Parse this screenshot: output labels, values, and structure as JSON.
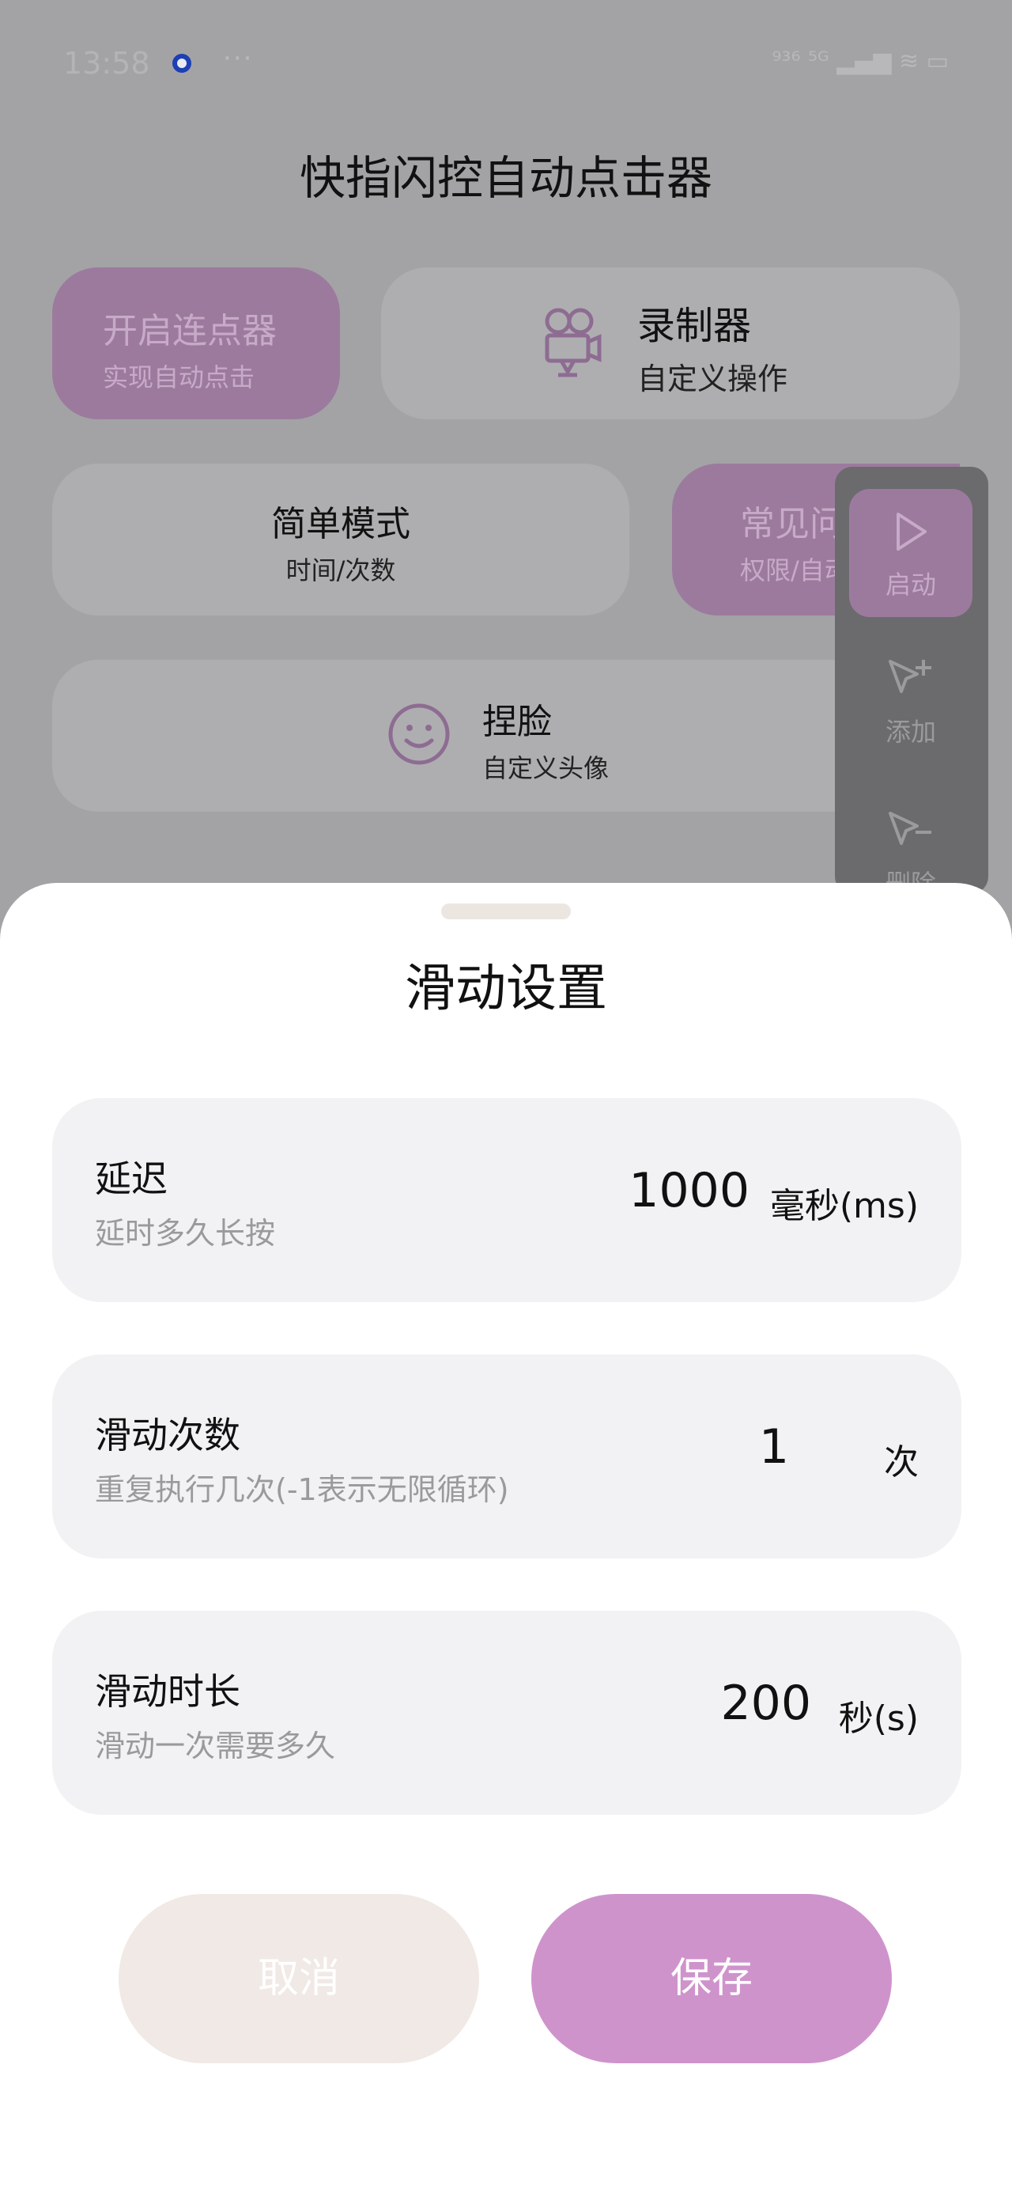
{
  "status_bar": {
    "time": "13:58",
    "more": "···",
    "right": "⁹³⁶ ⁵ᴳ ▂▄▆ ≋ ▭"
  },
  "app": {
    "title": "快指闪控自动点击器"
  },
  "cards": {
    "start_clicker": {
      "title": "开启连点器",
      "subtitle": "实现自动点击"
    },
    "recorder": {
      "title": "录制器",
      "subtitle": "自定义操作"
    },
    "simple_mode": {
      "title": "简单模式",
      "subtitle": "时间/次数"
    },
    "faq": {
      "title": "常见问",
      "subtitle": "权限/自动"
    },
    "pinch_face": {
      "title": "捏脸",
      "subtitle": "自定义头像"
    }
  },
  "float_panel": {
    "start": "启动",
    "add": "添加",
    "remove": "删除"
  },
  "sheet": {
    "title": "滑动设置",
    "rows": [
      {
        "label": "延迟",
        "desc": "延时多久长按",
        "value": "1000",
        "unit": "毫秒(ms)"
      },
      {
        "label": "滑动次数",
        "desc": "重复执行几次(-1表示无限循环)",
        "value": "1",
        "unit": "次"
      },
      {
        "label": "滑动时长",
        "desc": "滑动一次需要多久",
        "value": "200",
        "unit": "秒(s)"
      }
    ],
    "cancel": "取消",
    "save": "保存"
  },
  "colors": {
    "accent": "#cf93cc",
    "dim_accent": "#9c7a9e",
    "cancel_bg": "#f0e9e5"
  }
}
